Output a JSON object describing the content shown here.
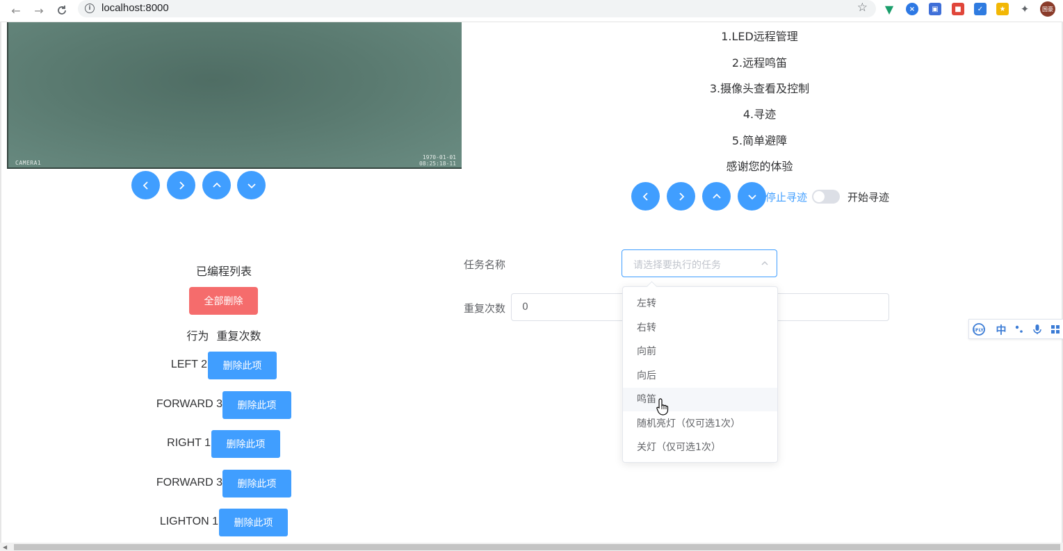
{
  "browser": {
    "url": "localhost:8000",
    "avatar_text": "国豪"
  },
  "camera": {
    "label": "CAMERA1",
    "date": "1970-01-01",
    "time": "08:25:18-11"
  },
  "intro": {
    "lines": [
      "1.LED远程管理",
      "2.远程鸣笛",
      "3.摄像头查看及控制",
      "4.寻迹",
      "5.简单避障",
      "感谢您的体验"
    ]
  },
  "tracking_switch": {
    "inactive_text": "停止寻迹",
    "active_text": "开始寻迹",
    "checked": false
  },
  "program_list": {
    "title": "已编程列表",
    "delete_all_label": "全部删除",
    "headers": [
      "行为",
      "重复次数"
    ],
    "delete_label": "删除此项",
    "items": [
      {
        "text": "LEFT 2"
      },
      {
        "text": "FORWARD 3"
      },
      {
        "text": "RIGHT 1"
      },
      {
        "text": "FORWARD 3"
      },
      {
        "text": "LIGHTON 1"
      }
    ]
  },
  "form": {
    "task_label": "任务名称",
    "task_placeholder": "请选择要执行的任务",
    "repeat_label": "重复次数",
    "repeat_value": "0"
  },
  "dropdown": {
    "options": [
      "左转",
      "右转",
      "向前",
      "向后",
      "鸣笛",
      "随机亮灯（仅可选1次）",
      "关灯（仅可选1次）"
    ],
    "hovered": "鸣笛"
  },
  "ime": {
    "lang": "中"
  },
  "colors": {
    "primary": "#409eff",
    "danger": "#f56c6c"
  }
}
